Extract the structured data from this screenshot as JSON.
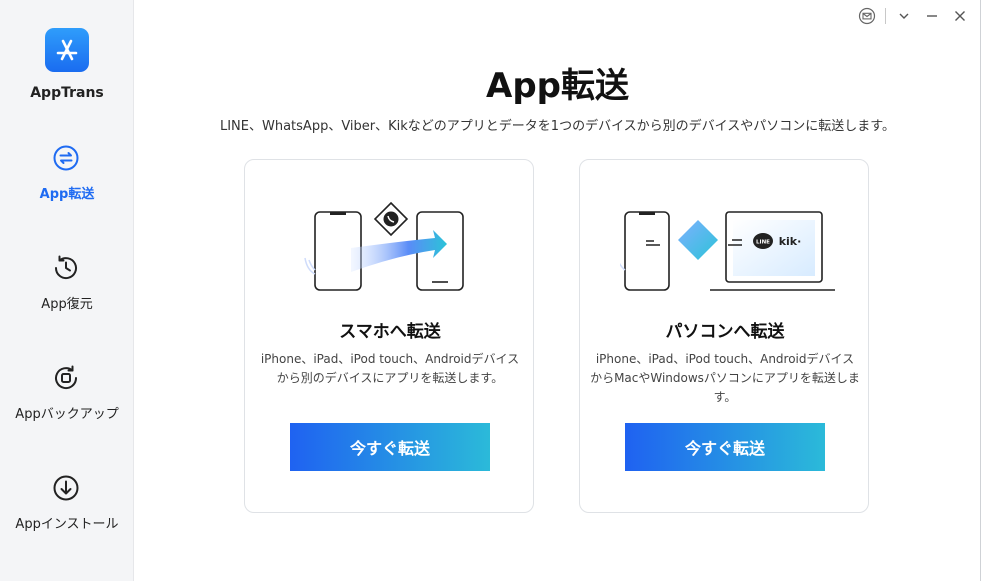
{
  "app": {
    "name": "AppTrans"
  },
  "sidebar": {
    "items": [
      {
        "label": "App転送",
        "icon": "transfer-icon",
        "active": true
      },
      {
        "label": "App復元",
        "icon": "restore-icon",
        "active": false
      },
      {
        "label": "Appバックアップ",
        "icon": "backup-icon",
        "active": false
      },
      {
        "label": "Appインストール",
        "icon": "install-icon",
        "active": false
      }
    ]
  },
  "window_controls": [
    "mail-icon",
    "chevron-down-icon",
    "minimize-icon",
    "close-icon"
  ],
  "main": {
    "title": "App転送",
    "subtitle": "LINE、WhatsApp、Viber、Kikなどのアプリとデータを1つのデバイスから別のデバイスやパソコンに転送します。",
    "cards": [
      {
        "title": "スマホへ転送",
        "description": "iPhone、iPad、iPod touch、Androidデバイスから別のデバイスにアプリを転送します。",
        "button": "今すぐ転送"
      },
      {
        "title": "パソコンへ転送",
        "description": "iPhone、iPad、iPod touch、AndroidデバイスからMacやWindowsパソコンにアプリを転送します。",
        "button": "今すぐ転送"
      }
    ],
    "illustration_labels": {
      "line": "LINE",
      "kik": "kik·"
    }
  },
  "colors": {
    "accent": "#1f6bf2",
    "button_start": "#1f62f1",
    "button_end": "#2bbad9",
    "sidebar_bg": "#f4f5f7"
  }
}
